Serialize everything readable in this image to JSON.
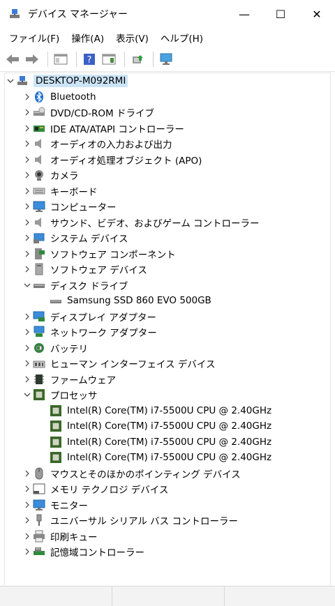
{
  "window": {
    "title": "デバイス マネージャー",
    "controls": {
      "minimize": "—",
      "maximize": "☐",
      "close": "✕"
    }
  },
  "menu": [
    "ファイル(F)",
    "操作(A)",
    "表示(V)",
    "ヘルプ(H)"
  ],
  "toolbar": {
    "buttons": [
      "back-arrow-icon",
      "forward-arrow-icon",
      "properties-icon",
      "help-icon",
      "action-pane-icon",
      "update-driver-icon",
      "scan-hardware-icon"
    ]
  },
  "tree": {
    "root": "DESKTOP-M092RMI",
    "categories": [
      {
        "label": "Bluetooth",
        "icon": "bluetooth-icon"
      },
      {
        "label": "DVD/CD-ROM ドライブ",
        "icon": "dvd-drive-icon"
      },
      {
        "label": "IDE ATA/ATAPI コントローラー",
        "icon": "ide-controller-icon"
      },
      {
        "label": "オーディオの入力および出力",
        "icon": "speaker-icon"
      },
      {
        "label": "オーディオ処理オブジェクト (APO)",
        "icon": "speaker-icon"
      },
      {
        "label": "カメラ",
        "icon": "camera-icon"
      },
      {
        "label": "キーボード",
        "icon": "keyboard-icon"
      },
      {
        "label": "コンピューター",
        "icon": "monitor-icon"
      },
      {
        "label": "サウンド、ビデオ、およびゲーム コントローラー",
        "icon": "speaker-icon"
      },
      {
        "label": "システム デバイス",
        "icon": "system-device-icon"
      },
      {
        "label": "ソフトウェア コンポーネント",
        "icon": "software-component-icon"
      },
      {
        "label": "ソフトウェア デバイス",
        "icon": "software-device-icon"
      },
      {
        "label": "ディスク ドライブ",
        "icon": "disk-drive-icon",
        "expanded": true,
        "children": [
          "Samsung SSD 860 EVO 500GB"
        ]
      },
      {
        "label": "ディスプレイ アダプター",
        "icon": "display-adapter-icon"
      },
      {
        "label": "ネットワーク アダプター",
        "icon": "network-adapter-icon"
      },
      {
        "label": "バッテリ",
        "icon": "battery-icon"
      },
      {
        "label": "ヒューマン インターフェイス デバイス",
        "icon": "hid-icon"
      },
      {
        "label": "ファームウェア",
        "icon": "firmware-icon"
      },
      {
        "label": "プロセッサ",
        "icon": "processor-icon",
        "expanded": true,
        "children": [
          "Intel(R) Core(TM) i7-5500U CPU @ 2.40GHz",
          "Intel(R) Core(TM) i7-5500U CPU @ 2.40GHz",
          "Intel(R) Core(TM) i7-5500U CPU @ 2.40GHz",
          "Intel(R) Core(TM) i7-5500U CPU @ 2.40GHz"
        ]
      },
      {
        "label": "マウスとそのほかのポインティング デバイス",
        "icon": "mouse-icon"
      },
      {
        "label": "メモリ テクノロジ デバイス",
        "icon": "memory-device-icon"
      },
      {
        "label": "モニター",
        "icon": "monitor-icon"
      },
      {
        "label": "ユニバーサル シリアル バス コントローラー",
        "icon": "usb-icon"
      },
      {
        "label": "印刷キュー",
        "icon": "printer-icon"
      },
      {
        "label": "記憶域コントローラー",
        "icon": "storage-controller-icon"
      }
    ]
  },
  "colors": {
    "selection": "#cce4f7",
    "accent": "#0078d4"
  }
}
